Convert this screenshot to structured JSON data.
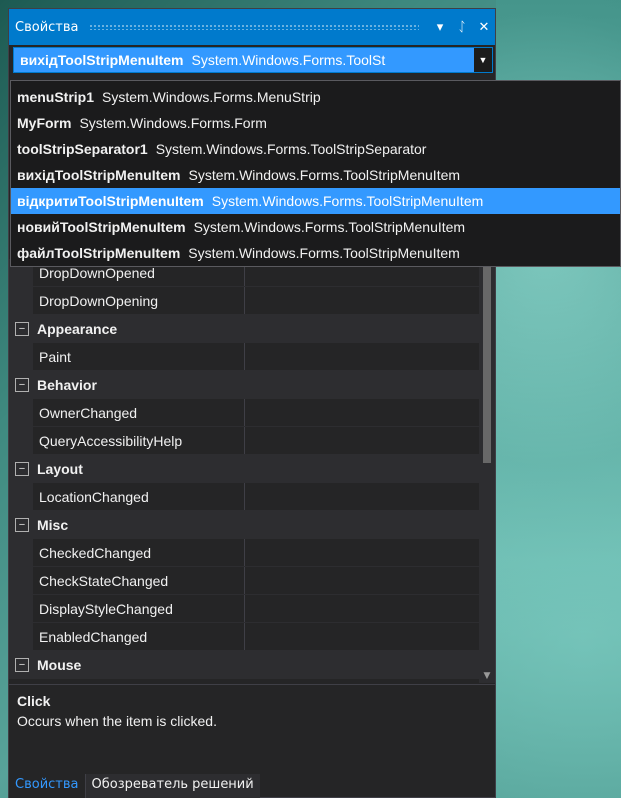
{
  "window": {
    "title": "Свойства",
    "dropdown_icon": "▾",
    "pin_icon": "ᛇ",
    "close_icon": "✕"
  },
  "selector": {
    "name": "вихідToolStripMenuItem",
    "type": "System.Windows.Forms.ToolSt",
    "arrow": "▼"
  },
  "dropdown_items": [
    {
      "name": "menuStrip1",
      "type": "System.Windows.Forms.MenuStrip"
    },
    {
      "name": "MyForm",
      "type": "System.Windows.Forms.Form"
    },
    {
      "name": "toolStripSeparator1",
      "type": "System.Windows.Forms.ToolStripSeparator"
    },
    {
      "name": "вихідToolStripMenuItem",
      "type": "System.Windows.Forms.ToolStripMenuItem"
    },
    {
      "name": "відкритиToolStripMenuItem",
      "type": "System.Windows.Forms.ToolStripMenuItem"
    },
    {
      "name": "новийToolStripMenuItem",
      "type": "System.Windows.Forms.ToolStripMenuItem"
    },
    {
      "name": "файлToolStripMenuItem",
      "type": "System.Windows.Forms.ToolStripMenuItem"
    }
  ],
  "selected_dropdown_index": 4,
  "grid": {
    "rows": [
      {
        "kind": "prop",
        "name": "DropDownOpened"
      },
      {
        "kind": "prop",
        "name": "DropDownOpening"
      },
      {
        "kind": "cat",
        "name": "Appearance",
        "toggle": "⊟"
      },
      {
        "kind": "prop",
        "name": "Paint"
      },
      {
        "kind": "cat",
        "name": "Behavior",
        "toggle": "⊟"
      },
      {
        "kind": "prop",
        "name": "OwnerChanged"
      },
      {
        "kind": "prop",
        "name": "QueryAccessibilityHelp"
      },
      {
        "kind": "cat",
        "name": "Layout",
        "toggle": "⊟"
      },
      {
        "kind": "prop",
        "name": "LocationChanged"
      },
      {
        "kind": "cat",
        "name": "Misc",
        "toggle": "⊟"
      },
      {
        "kind": "prop",
        "name": "CheckedChanged"
      },
      {
        "kind": "prop",
        "name": "CheckStateChanged"
      },
      {
        "kind": "prop",
        "name": "DisplayStyleChanged"
      },
      {
        "kind": "prop",
        "name": "EnabledChanged"
      },
      {
        "kind": "cat",
        "name": "Mouse",
        "toggle": "⊟"
      }
    ]
  },
  "scroll_arrow": "▼",
  "description": {
    "title": "Click",
    "text": "Occurs when the item is clicked."
  },
  "tabs": [
    {
      "label": "Свойства",
      "active": true
    },
    {
      "label": "Обозреватель решений",
      "active": false
    }
  ]
}
